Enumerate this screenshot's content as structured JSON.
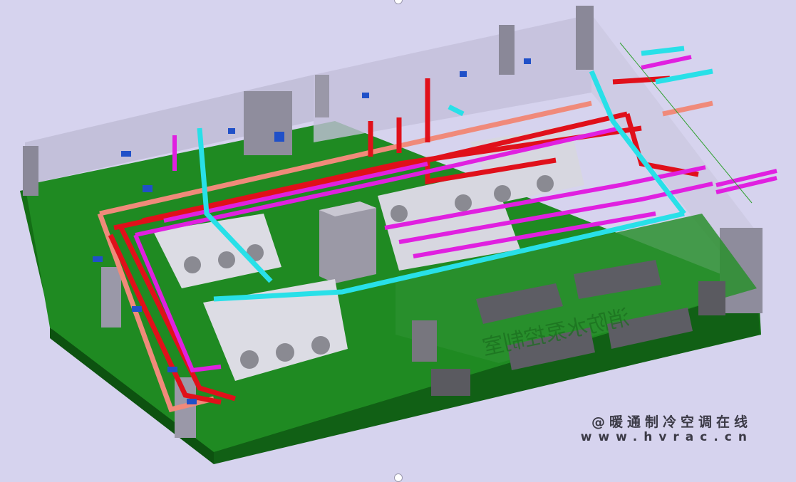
{
  "room_label": "消防水泵控制室",
  "watermark": {
    "line1": "@暖通制冷空调在线",
    "line2": "www.hvrac.cn"
  },
  "colors": {
    "background": "#d6d3ee",
    "floor": "#1d7d1d",
    "wall": "#b7b2c8",
    "chilled_pipe": "#e0101a",
    "magenta_pipe": "#e020e0",
    "cyan_pipe": "#28e0e8",
    "salmon_pipe": "#f08a7a",
    "equipment": "#6e6e74"
  }
}
